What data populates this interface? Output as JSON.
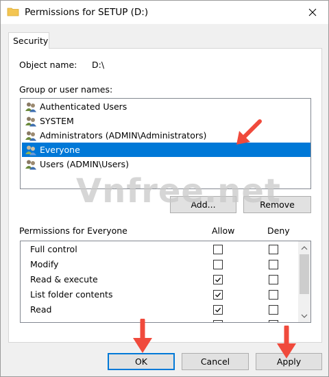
{
  "window": {
    "title": "Permissions for SETUP (D:)",
    "close_icon": "close-icon"
  },
  "tabs": [
    {
      "label": "Security",
      "selected": true
    }
  ],
  "object_name": {
    "label": "Object name:",
    "value": "D:\\"
  },
  "group_section": {
    "label": "Group or user names:",
    "users": [
      {
        "name": "Authenticated Users",
        "icon": "user-group-icon",
        "selected": false
      },
      {
        "name": "SYSTEM",
        "icon": "user-group-icon",
        "selected": false
      },
      {
        "name": "Administrators (ADMIN\\Administrators)",
        "icon": "user-group-icon",
        "selected": false
      },
      {
        "name": "Everyone",
        "icon": "user-group-icon",
        "selected": true
      },
      {
        "name": "Users (ADMIN\\Users)",
        "icon": "user-group-icon",
        "selected": false
      }
    ],
    "add_button": "Add...",
    "remove_button": "Remove"
  },
  "permissions": {
    "label": "Permissions for Everyone",
    "allow_header": "Allow",
    "deny_header": "Deny",
    "rows": [
      {
        "name": "Full control",
        "allow": false,
        "deny": false
      },
      {
        "name": "Modify",
        "allow": false,
        "deny": false
      },
      {
        "name": "Read & execute",
        "allow": true,
        "deny": false
      },
      {
        "name": "List folder contents",
        "allow": true,
        "deny": false
      },
      {
        "name": "Read",
        "allow": true,
        "deny": false
      }
    ]
  },
  "footer": {
    "ok": "OK",
    "cancel": "Cancel",
    "apply": "Apply"
  },
  "watermark": "Vnfree.net",
  "colors": {
    "selection": "#0078d7",
    "annotation_arrow": "#f04a3c"
  }
}
